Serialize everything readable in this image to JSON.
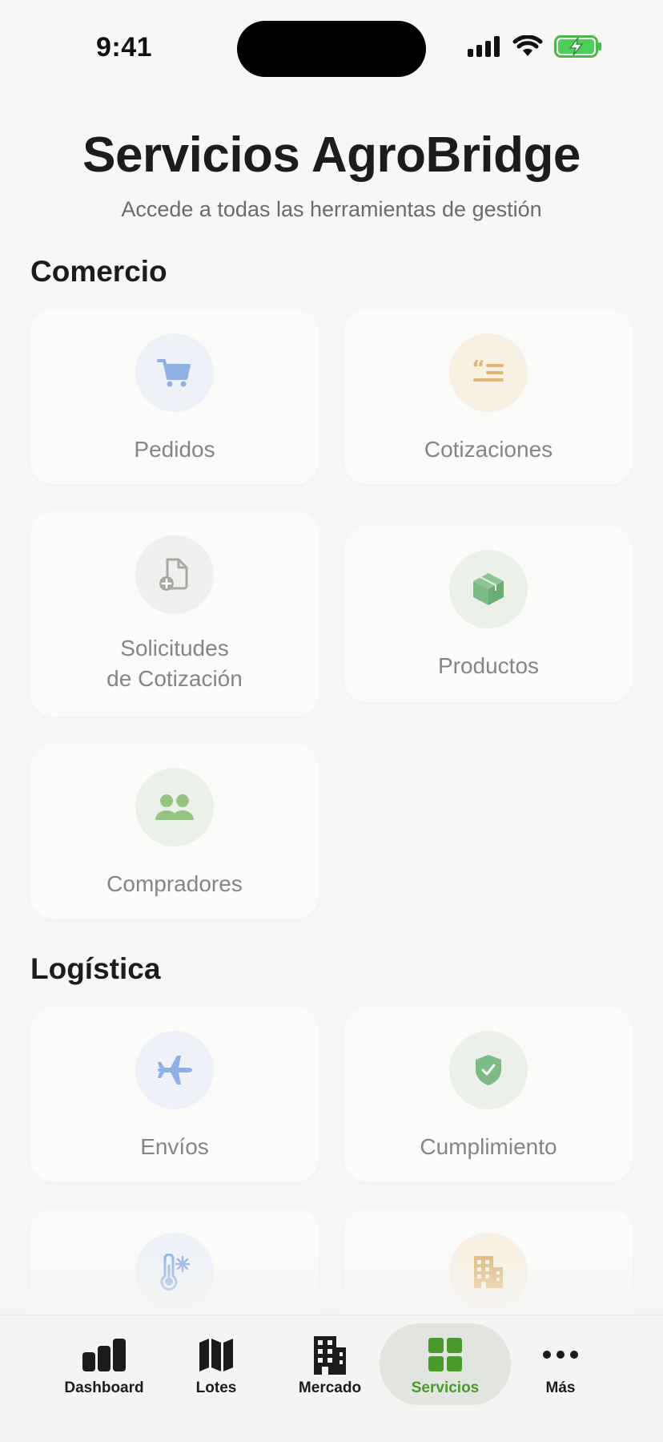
{
  "status_bar": {
    "time": "9:41"
  },
  "header": {
    "title": "Servicios AgroBridge",
    "subtitle": "Accede a todas las herramientas de gestión"
  },
  "sections": [
    {
      "title": "Comercio",
      "items": [
        {
          "label": "Pedidos",
          "icon": "cart-icon",
          "color": "#8fb0e4"
        },
        {
          "label": "Cotizaciones",
          "icon": "quote-list-icon",
          "color": "#e0b87a"
        },
        {
          "label_line1": "Solicitudes",
          "label_line2": "de Cotización",
          "icon": "document-add-icon",
          "color": "#a8a8a4"
        },
        {
          "label": "Productos",
          "icon": "box-icon",
          "color": "#7dbb86"
        },
        {
          "label": "Compradores",
          "icon": "people-icon",
          "color": "#96c384"
        }
      ]
    },
    {
      "title": "Logística",
      "items": [
        {
          "label": "Envíos",
          "icon": "airplane-icon",
          "color": "#8fb0e4"
        },
        {
          "label": "Cumplimiento",
          "icon": "shield-check-icon",
          "color": "#7dbb86"
        },
        {
          "label": "",
          "icon": "thermometer-snow-icon",
          "color": "#8fb0e4"
        },
        {
          "label": "",
          "icon": "building-icon",
          "color": "#e0b87a"
        }
      ]
    }
  ],
  "tab_bar": {
    "tabs": [
      {
        "label": "Dashboard",
        "icon": "bar-chart-icon"
      },
      {
        "label": "Lotes",
        "icon": "map-icon"
      },
      {
        "label": "Mercado",
        "icon": "building-icon"
      },
      {
        "label": "Servicios",
        "icon": "grid-icon",
        "active": true
      },
      {
        "label": "Más",
        "icon": "more-icon"
      }
    ],
    "active_color": "#4b9a2c"
  }
}
